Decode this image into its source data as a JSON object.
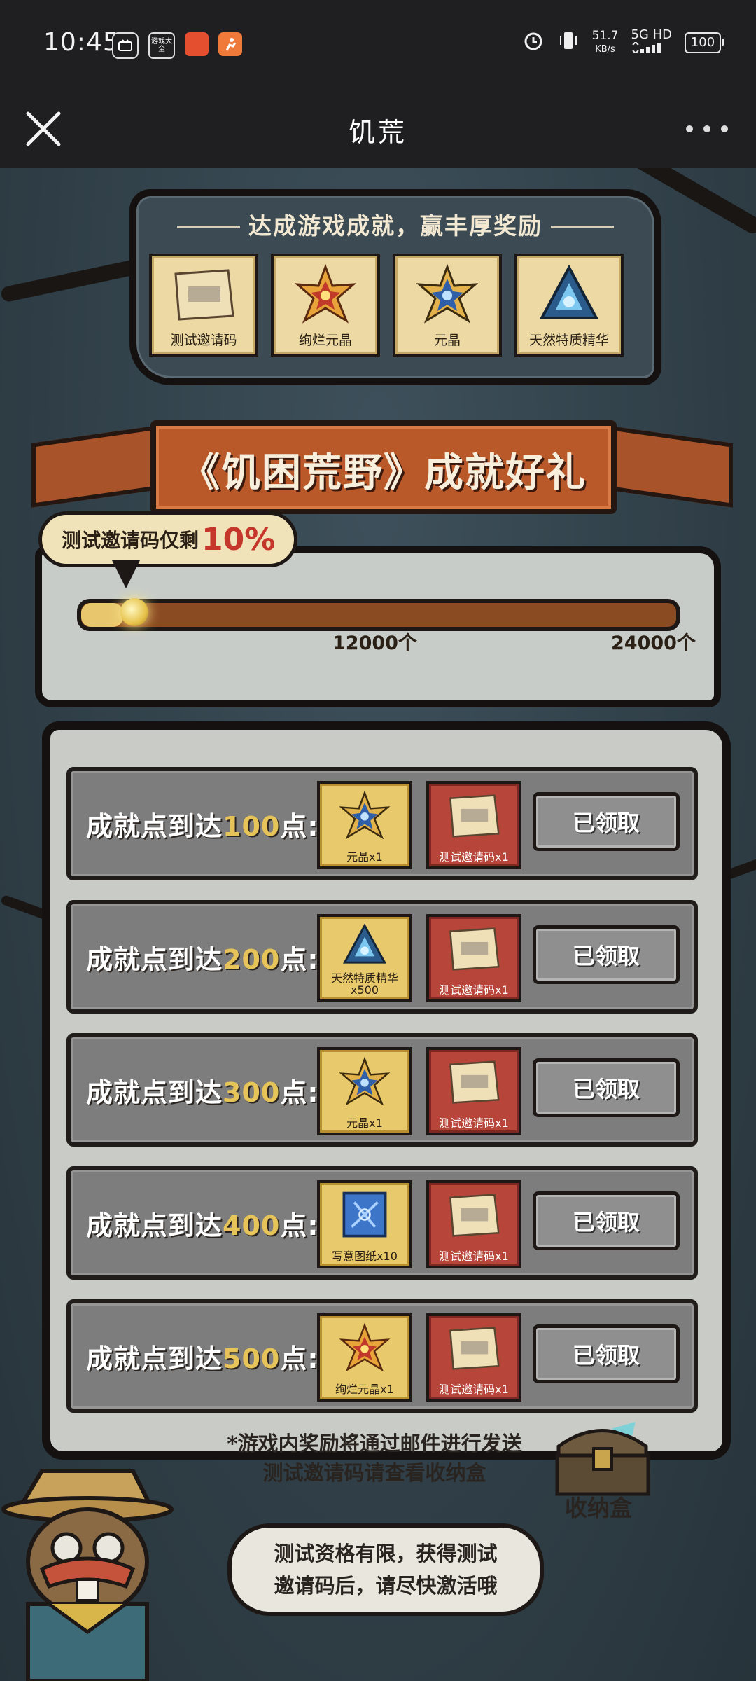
{
  "status_bar": {
    "time": "10:45",
    "apps": [
      {
        "name": "tv-app-icon",
        "label": ""
      },
      {
        "name": "game-center-app-icon",
        "label": "游戏大全"
      },
      {
        "name": "orange-app-icon",
        "label": ""
      },
      {
        "name": "runner-app-icon",
        "label": ""
      }
    ],
    "net_speed": "51.7",
    "net_unit": "KB/s",
    "network": "5G HD",
    "battery": "100"
  },
  "nav": {
    "title": "饥荒"
  },
  "top_rewards": {
    "title": "达成游戏成就，赢丰厚奖励",
    "items": [
      {
        "label": "测试邀请码",
        "icon": "scroll-icon"
      },
      {
        "label": "绚烂元晶",
        "icon": "radiant-crystal-icon"
      },
      {
        "label": "元晶",
        "icon": "crystal-icon"
      },
      {
        "label": "天然特质精华",
        "icon": "essence-icon"
      }
    ]
  },
  "banner": {
    "title": "《饥困荒野》成就好礼"
  },
  "progress": {
    "bubble_prefix": "测试邀请码仅剩",
    "bubble_percent": "10%",
    "remaining_fraction": 0.1,
    "fill_fraction": 0.07,
    "ticks": [
      "12000个",
      "24000个"
    ]
  },
  "milestones": [
    {
      "label_prefix": "成就点到达",
      "points": "100",
      "label_suffix": "点:",
      "reward1": {
        "label": "元晶x1",
        "icon": "crystal-icon"
      },
      "reward2": {
        "label": "测试邀请码x1",
        "icon": "scroll-icon"
      },
      "button": "已领取"
    },
    {
      "label_prefix": "成就点到达",
      "points": "200",
      "label_suffix": "点:",
      "reward1": {
        "label": "天然特质精华 x500",
        "icon": "essence-icon"
      },
      "reward2": {
        "label": "测试邀请码x1",
        "icon": "scroll-icon"
      },
      "button": "已领取"
    },
    {
      "label_prefix": "成就点到达",
      "points": "300",
      "label_suffix": "点:",
      "reward1": {
        "label": "元晶x1",
        "icon": "crystal-icon"
      },
      "reward2": {
        "label": "测试邀请码x1",
        "icon": "scroll-icon"
      },
      "button": "已领取"
    },
    {
      "label_prefix": "成就点到达",
      "points": "400",
      "label_suffix": "点:",
      "reward1": {
        "label": "写意图纸x10",
        "icon": "blueprint-icon"
      },
      "reward2": {
        "label": "测试邀请码x1",
        "icon": "scroll-icon"
      },
      "button": "已领取"
    },
    {
      "label_prefix": "成就点到达",
      "points": "500",
      "label_suffix": "点:",
      "reward1": {
        "label": "绚烂元晶x1",
        "icon": "radiant-crystal-icon"
      },
      "reward2": {
        "label": "测试邀请码x1",
        "icon": "scroll-icon"
      },
      "button": "已领取"
    }
  ],
  "note": {
    "line1": "*游戏内奖励将通过邮件进行发送",
    "line2": "测试邀请码请查看收纳盒"
  },
  "chest": {
    "label": "收纳盒"
  },
  "speech": {
    "line1": "测试资格有限，获得测试",
    "line2": "邀请码后，请尽快激活哦"
  },
  "colors": {
    "accent_gold": "#e7c45a",
    "accent_red": "#c5372a",
    "banner_orange": "#b9592a"
  }
}
